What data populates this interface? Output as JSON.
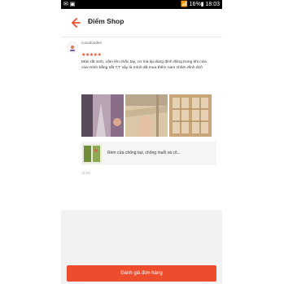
{
  "status_bar": {
    "left_icons": "✉ ▣",
    "right_text": "📶 16%▮ 18:03"
  },
  "header": {
    "back_icon": "arrow-left-icon",
    "title": "Điểm Shop"
  },
  "review": {
    "username": "cuvodouden",
    "stars": "★★★★★",
    "rating": 5,
    "text": "Màn rất xinh, cầm lên chắc tay, cơ mà lại dùng đinh đóng trong khi cửa của mình bằng sắt T.T vậy là mình đã mua thêm nam châm đính dzô",
    "photos": [
      "photo-1",
      "photo-2",
      "photo-3"
    ],
    "product": {
      "name": "Rèm cửa chống bụi, chống muỗi và cô..."
    },
    "time": "11:02"
  },
  "footer": {
    "rate_button": "Đánh giá đơn hàng"
  },
  "colors": {
    "accent": "#ee4d2d",
    "status_bar": "#000000",
    "background": "#f2f2f2"
  }
}
